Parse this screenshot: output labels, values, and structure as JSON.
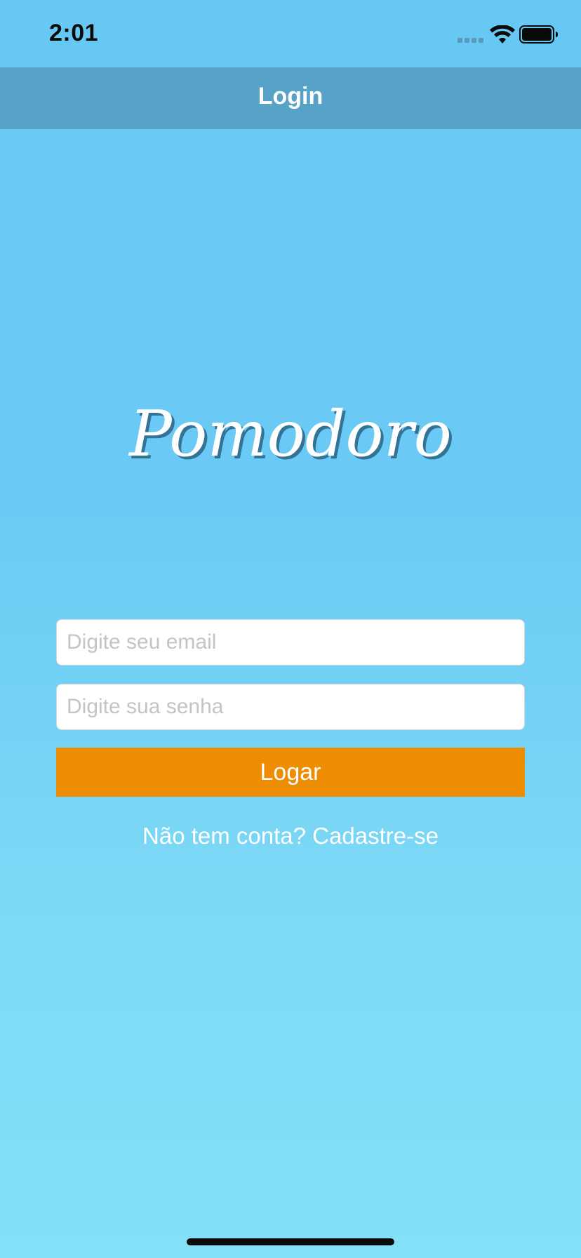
{
  "status_bar": {
    "time": "2:01",
    "icons": [
      "cellular-signal-icon",
      "wifi-icon",
      "battery-icon"
    ]
  },
  "nav": {
    "title": "Login"
  },
  "logo": {
    "text": "Pomodoro"
  },
  "form": {
    "email_placeholder": "Digite seu email",
    "email_value": "",
    "password_placeholder": "Digite sua senha",
    "password_value": "",
    "login_label": "Logar",
    "signup_label": "Não tem conta? Cadastre-se"
  },
  "colors": {
    "background_top": "#68c8f4",
    "background_bottom": "#84e0f7",
    "nav_bar": "#57a3c7",
    "button": "#ee8c02",
    "text_light": "#ffffff"
  }
}
